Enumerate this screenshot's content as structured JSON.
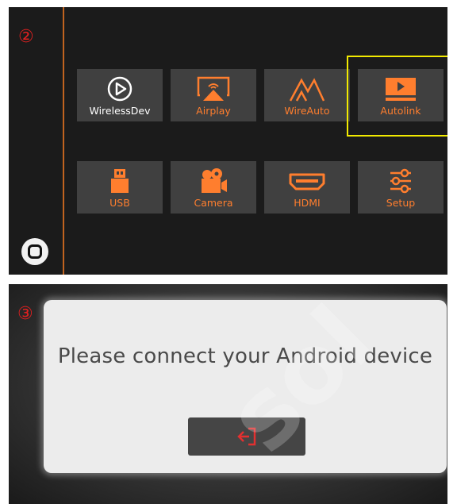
{
  "panel1": {
    "step_label": "②",
    "tiles": [
      {
        "label": "WirelessDev",
        "icon": "play-circle-icon"
      },
      {
        "label": "Airplay",
        "icon": "airplay-icon"
      },
      {
        "label": "WireAuto",
        "icon": "mountain-icon"
      },
      {
        "label": "Autolink",
        "icon": "autolink-screen-icon",
        "selected": true
      },
      {
        "label": "USB",
        "icon": "usb-drive-icon"
      },
      {
        "label": "Camera",
        "icon": "camera-icon"
      },
      {
        "label": "HDMI",
        "icon": "hdmi-icon"
      },
      {
        "label": "Setup",
        "icon": "sliders-icon"
      }
    ],
    "home_button_icon": "home-square-icon",
    "colors": {
      "accent": "#ff7e2e",
      "selection": "#f2ea00",
      "tile": "#404040",
      "background": "#1b1b1b"
    }
  },
  "panel2": {
    "step_label": "③",
    "message": "Please connect your Android device",
    "button_icon": "exit-icon",
    "watermark": "sol",
    "colors": {
      "dialog": "#ececec",
      "button": "#454545",
      "button_icon": "#e23030"
    }
  }
}
